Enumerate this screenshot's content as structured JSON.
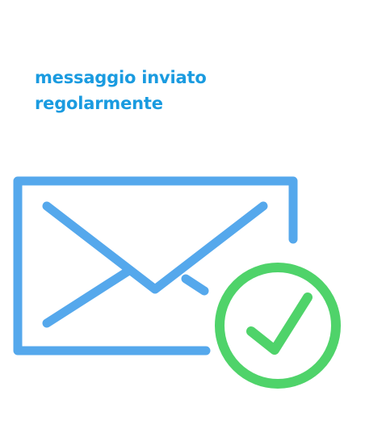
{
  "status": {
    "line1": "messaggio inviato",
    "line2": "regolarmente"
  },
  "icons": {
    "envelope": "envelope-icon",
    "check": "check-circle-icon"
  },
  "colors": {
    "text": "#1a9be0",
    "envelope": "#55a8ec",
    "check": "#4fd36a"
  }
}
